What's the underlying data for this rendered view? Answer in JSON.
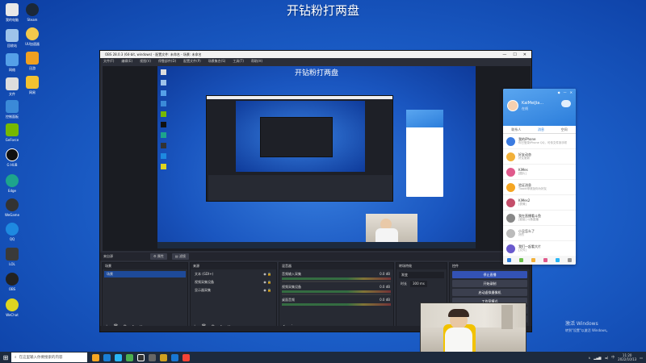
{
  "desktop": {
    "title": "开钻粉打两盘",
    "icons_left": [
      {
        "label": "我的电脑",
        "color": "#e8e8e8"
      },
      {
        "label": "回收站",
        "color": "#9ec3ea"
      },
      {
        "label": "网络",
        "color": "#55a0e8"
      },
      {
        "label": "文件",
        "color": "#ddd"
      },
      {
        "label": "控制面板",
        "color": "#3b8ad8"
      },
      {
        "label": "GeForce",
        "color": "#76b900"
      },
      {
        "label": "G HUB",
        "color": "#111"
      },
      {
        "label": "Edge",
        "color": "#1da48c"
      },
      {
        "label": "WeGame",
        "color": "#333"
      },
      {
        "label": "QQ",
        "color": "#1e89e0"
      },
      {
        "label": "LOL",
        "color": "#3a3a3a"
      },
      {
        "label": "OBS",
        "color": "#222"
      },
      {
        "label": "WeChat",
        "color": "#ddd520"
      }
    ],
    "icons_right": [
      {
        "label": "Steam",
        "color": "#1b2838"
      },
      {
        "label": "UU加速器",
        "color": "#f2c94c"
      },
      {
        "label": "迅游",
        "color": "#f0a020"
      },
      {
        "label": "网易",
        "color": "#f2c230"
      }
    ]
  },
  "obs": {
    "window_title": "OBS 28.0.3 (64-bit, windows) - 配置文件: 未命名 - 场景: 未命名",
    "menu": [
      "文件(F)",
      "编辑(E)",
      "视图(V)",
      "停靠部件(D)",
      "配置文件(P)",
      "场景集合(S)",
      "工具(T)",
      "帮助(H)"
    ],
    "preview_title": "开钻粉打两盘",
    "toolbar": {
      "source_label": "来自源",
      "props_label": "属性",
      "filter_label": "滤镜"
    },
    "docks": {
      "scenes": {
        "title": "场景",
        "items": [
          "场景"
        ]
      },
      "sources": {
        "title": "来源",
        "items": [
          "文本 (GDI+)",
          "视频采集设备",
          "显示器采集"
        ]
      },
      "mixer": {
        "title": "混音器",
        "channels": [
          {
            "name": "音频输入采集",
            "db": "0.0 dB"
          },
          {
            "name": "视频采集设备",
            "db": "0.0 dB"
          },
          {
            "name": "桌面音频",
            "db": "0.0 dB"
          }
        ]
      },
      "transitions": {
        "title": "转场特效",
        "type": "渐变",
        "duration_label": "时长",
        "duration": "300 ms"
      },
      "controls": {
        "title": "控件",
        "buttons": [
          "停止直播",
          "开始录制",
          "启动虚拟摄像机",
          "工作室模式",
          "设置",
          "退出"
        ]
      }
    },
    "status": "LIVE: 00:00:00  REC: 00:00:00  CPU: 4.2%, 60.00 fps"
  },
  "qq": {
    "username": "KaiMeiJia...",
    "status": "在线",
    "tabs": [
      "联系人",
      "消息",
      "空间"
    ],
    "messages": [
      {
        "name": "我的iPhone",
        "preview": "你已登录iPhone QQ，可传文件到手机",
        "color": "#3b7be0"
      },
      {
        "name": "好友动态",
        "preview": "好友更新",
        "color": "#f2b13a"
      },
      {
        "name": "KiMes",
        "preview": "[图片]",
        "color": "#e05a8c"
      },
      {
        "name": "验证消息",
        "preview": "Tiaodl申请加你为好友",
        "color": "#f5a623"
      },
      {
        "name": "KiMes2",
        "preview": "[表情]",
        "color": "#c44e6a"
      },
      {
        "name": "我在直播看斗鱼",
        "preview": "[链接] 斗鱼直播",
        "color": "#888"
      },
      {
        "name": "小丑怎么了",
        "preview": "好的",
        "color": "#bbb"
      },
      {
        "name": "我们一起看大片",
        "preview": "[文件]",
        "color": "#6a5acd"
      }
    ]
  },
  "watermark": {
    "line1": "激活 Windows",
    "line2": "转到\"设置\"以激活 Windows。"
  },
  "taskbar": {
    "search_placeholder": "在这里输入你要搜索的内容",
    "time": "11:20",
    "date": "2022/10/13",
    "apps": [
      "#f5a623",
      "#1a7fd6",
      "#29b6f6",
      "#4caf50",
      "#333",
      "#666",
      "#d0a020",
      "#1976d2",
      "#f44336"
    ]
  }
}
